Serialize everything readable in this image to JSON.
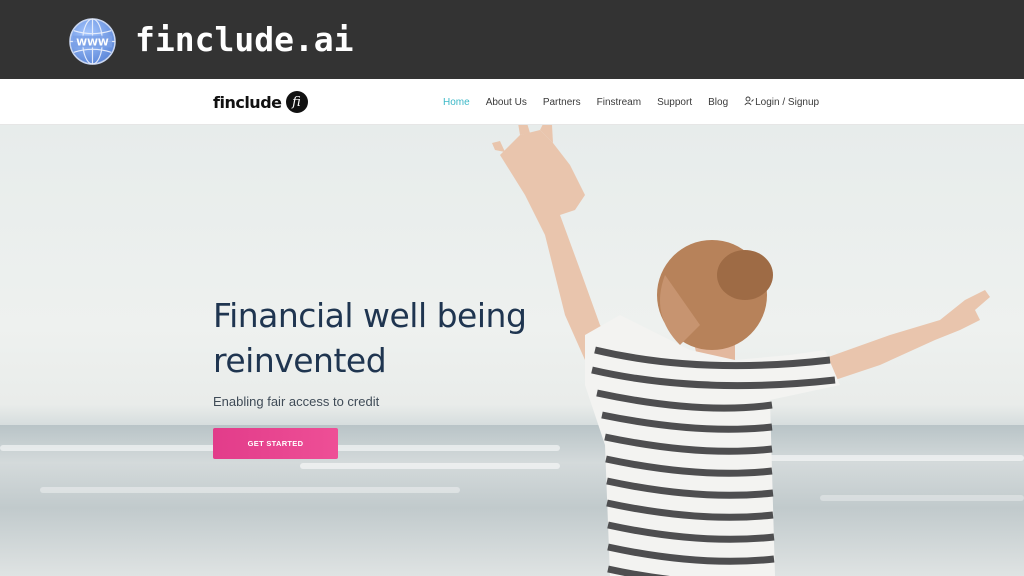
{
  "banner": {
    "title": "finclude.ai",
    "icon": "www-globe-icon"
  },
  "navbar": {
    "logo_text": "finclude",
    "logo_badge": "fi",
    "links": [
      {
        "label": "Home",
        "active": true
      },
      {
        "label": "About Us"
      },
      {
        "label": "Partners"
      },
      {
        "label": "Finstream"
      },
      {
        "label": "Support"
      },
      {
        "label": "Blog"
      },
      {
        "label": "Login / Signup",
        "icon": "user-icon"
      }
    ]
  },
  "hero": {
    "title": "Financial well being reinvented",
    "subtitle": "Enabling fair access to credit",
    "cta_label": "GET STARTED"
  },
  "colors": {
    "banner_bg": "#333333",
    "accent_active": "#3bb8c7",
    "cta_pink": "#e23c8a",
    "heading": "#1f3550"
  }
}
